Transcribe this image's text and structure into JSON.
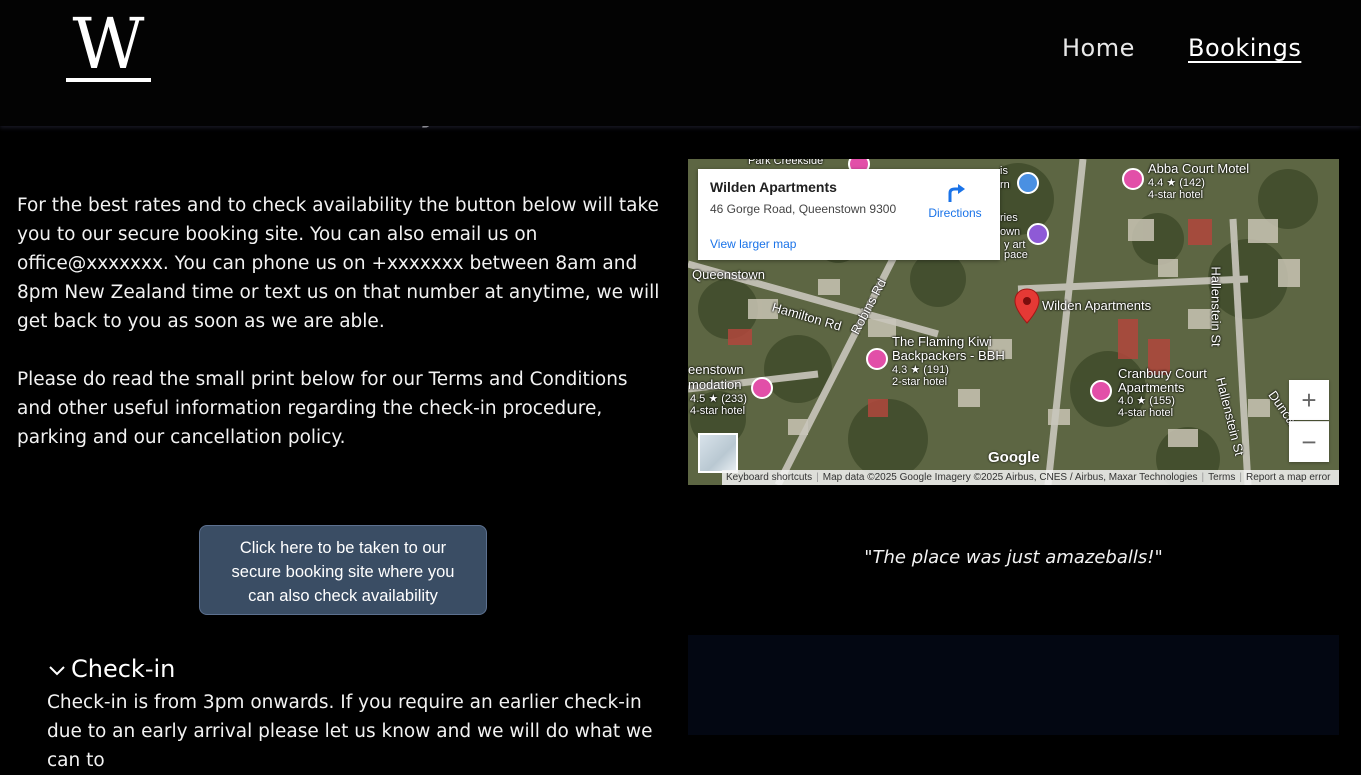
{
  "header": {
    "logo_letter": "W",
    "nav": {
      "home": "Home",
      "bookings": "Bookings"
    }
  },
  "intro": {
    "paragraph1": "For the best rates and to check availability the button below will take you to our secure booking site. You can also email us on office@xxxxxxx. You can phone us on +xxxxxxx between 8am and 8pm New Zealand time or text us on that number at anytime, we will get back to you as soon as we are able.",
    "paragraph2": "Please do read the small print below for our Terms and Conditions and other useful information regarding the check-in procedure, parking and our cancellation policy."
  },
  "booking_button": {
    "label": "Click here to be taken to our secure booking site where you can also check availability"
  },
  "accordion": {
    "checkin_title": "Check-in",
    "checkin_body": "Check-in is from 3pm onwards. If you require an earlier check-in due to an early arrival please let us know and we will do what we can to"
  },
  "map": {
    "card": {
      "title": "Wilden Apartments",
      "address": "46 Gorge Road, Queenstown 9300",
      "directions": "Directions",
      "larger_map": "View larger map"
    },
    "labels": {
      "abba": "Abba Court Motel",
      "abba_rating": "4.4 ★ (142)",
      "abba_type": "4-star hotel",
      "park_creekside": "Park Creekside",
      "queenstown": "Queenstown",
      "hamilton": "Hamilton Rd",
      "robins": "Robins Rd",
      "wilden": "Wilden Apartments",
      "flaming_kiwi_1": "The Flaming Kiwi",
      "flaming_kiwi_2": "Backpackers - BBH",
      "flaming_rating": "4.3 ★ (191)",
      "flaming_type": "2-star hotel",
      "accommodation_1": "eenstown",
      "accommodation_2": "modation",
      "acc_rating": "4.5 ★ (233)",
      "acc_type": "4-star hotel",
      "cranbury_1": "Cranbury Court",
      "cranbury_2": "Apartments",
      "cranbury_rating": "4.0 ★ (155)",
      "cranbury_type": "4-star hotel",
      "hallenstein": "Hallenstein St",
      "hallenstein2": "Hallenstein St",
      "duncan": "Duncan",
      "partial1": "ries",
      "partial2": "own",
      "partial3": "y art",
      "partial4": "pace",
      "partial5": "is",
      "partial6": "rn"
    },
    "zoom_in": "+",
    "zoom_out": "−",
    "google": "Google",
    "footer": {
      "keyboard": "Keyboard shortcuts",
      "data": "Map data ©2025 Google Imagery ©2025 Airbus, CNES / Airbus, Maxar Technologies",
      "terms": "Terms",
      "report": "Report a map error"
    }
  },
  "quote": "\"The place was just amazeballs!\""
}
